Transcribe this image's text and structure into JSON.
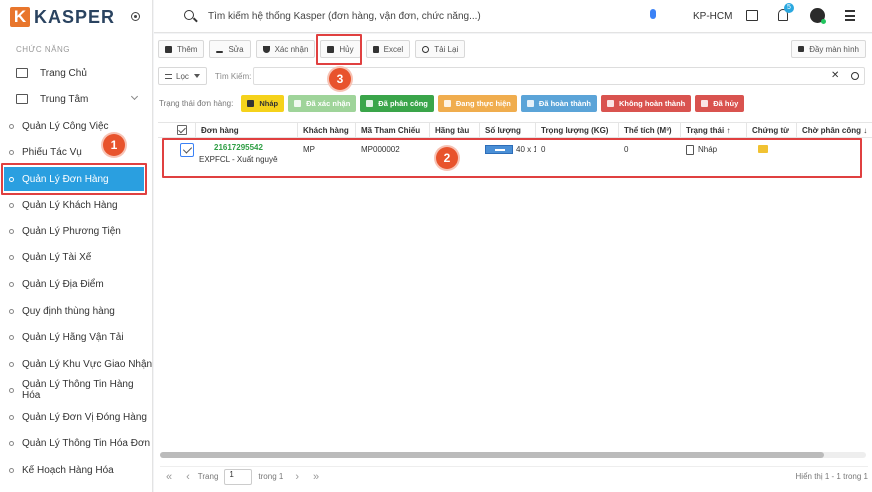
{
  "brand": {
    "logo_letter": "K",
    "name": "KASPER"
  },
  "sidebar": {
    "section_label": "CHỨC NĂNG",
    "top_items": [
      {
        "label": "Trang Chủ",
        "icon": "monitor-icon"
      },
      {
        "label": "Trung Tâm",
        "icon": "download-monitor-icon"
      }
    ],
    "items": [
      {
        "label": "Quản Lý Công Việc"
      },
      {
        "label": "Phiếu Tác Vụ"
      },
      {
        "label": "Quản Lý Đơn Hàng",
        "active": true
      },
      {
        "label": "Quản Lý Khách Hàng"
      },
      {
        "label": "Quản Lý Phương Tiện"
      },
      {
        "label": "Quản Lý Tài Xế"
      },
      {
        "label": "Quản Lý Địa Điểm"
      },
      {
        "label": "Quy định thùng hàng"
      },
      {
        "label": "Quản Lý Hãng Vận Tải"
      },
      {
        "label": "Quản Lý Khu Vực Giao Nhận"
      },
      {
        "label": "Quản Lý Thông Tin Hàng Hóa"
      },
      {
        "label": "Quản Lý Đơn Vị Đóng Hàng"
      },
      {
        "label": "Quản Lý Thông Tin Hóa Đơn"
      },
      {
        "label": "Kế Hoạch Hàng Hóa"
      }
    ]
  },
  "topbar": {
    "search_placeholder": "Tìm kiếm hệ thống Kasper (đơn hàng, vận đơn, chức năng...)",
    "region": "KP-HCM",
    "notification_count": "5"
  },
  "toolbar": {
    "buttons": [
      {
        "label": "Thêm",
        "icon": "plus-icon"
      },
      {
        "label": "Sửa",
        "icon": "pen-icon"
      },
      {
        "label": "Xác nhận",
        "icon": "shield-check-icon"
      },
      {
        "label": "Hủy",
        "icon": "cancel-icon"
      },
      {
        "label": "Excel",
        "icon": "download-icon"
      },
      {
        "label": "Tải Lại",
        "icon": "refresh-icon"
      }
    ],
    "fit_screen_label": "Đầy màn hình"
  },
  "filter": {
    "filter_label": "Lọc",
    "search_label": "Tìm Kiếm:",
    "search_value": ""
  },
  "status_filter": {
    "label": "Trạng thái đơn hàng:",
    "chips": [
      {
        "label": "Nháp",
        "color": "#f5d21b",
        "text_color": "#333333"
      },
      {
        "label": "Đã xác nhận",
        "color": "#9fd49a",
        "text_color": "#ffffff"
      },
      {
        "label": "Đã phân công",
        "color": "#3aa54a",
        "text_color": "#ffffff"
      },
      {
        "label": "Đang thực hiện",
        "color": "#f0ad4e",
        "text_color": "#ffffff"
      },
      {
        "label": "Đã hoàn thành",
        "color": "#5ba4d8",
        "text_color": "#ffffff"
      },
      {
        "label": "Không hoàn thành",
        "color": "#d9534f",
        "text_color": "#ffffff"
      },
      {
        "label": "Đã hủy",
        "color": "#d9534f",
        "text_color": "#ffffff"
      }
    ]
  },
  "table": {
    "columns": [
      "Đơn hàng",
      "Khách hàng",
      "Mã Tham Chiếu",
      "Hãng tàu",
      "Số lượng",
      "Trọng lượng (KG)",
      "Thể tích (M³)",
      "Trạng thái ↑",
      "Chứng từ",
      "Chờ phân công ↓"
    ],
    "rows": [
      {
        "order_code": "21617295542",
        "order_desc": "EXPFCL - Xuất nguyên cont",
        "customer": "MP",
        "reference": "MP000002",
        "carrier": "",
        "quantity": "40 x 1",
        "weight": "0",
        "volume": "0",
        "status": "Nháp",
        "documents": "",
        "pending": ""
      }
    ]
  },
  "pager": {
    "page_label": "Trang",
    "page_value": "1",
    "of_label": "trong 1",
    "info": "Hiển thị 1 - 1 trong 1"
  },
  "annotations": [
    "1",
    "2",
    "3"
  ],
  "accent_color": "#2a9fe0",
  "annotation_color": "#e04040"
}
